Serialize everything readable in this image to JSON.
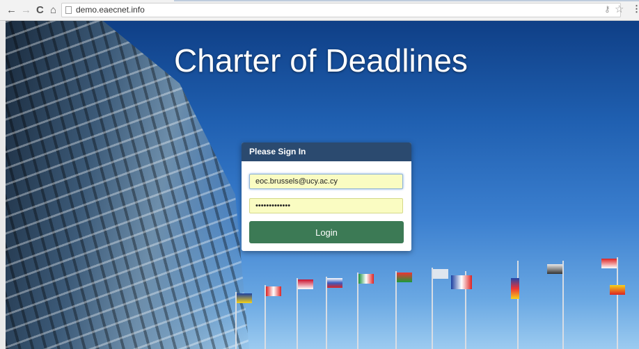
{
  "browser": {
    "url": "demo.eaecnet.info",
    "back_glyph": "←",
    "forward_glyph": "→",
    "reload_glyph": "C",
    "home_glyph": "⌂",
    "key_glyph": "⚷",
    "star_glyph": "☆",
    "menu_glyph": "⋮"
  },
  "page": {
    "title": "Charter of Deadlines"
  },
  "login": {
    "heading": "Please Sign In",
    "email_value": "eoc.brussels@ucy.ac.cy",
    "password_value": "•••••••••••••",
    "button_label": "Login"
  },
  "colors": {
    "panel_header": "#2b4a6f",
    "button": "#3c7a55",
    "field_bg": "#fafcc2"
  }
}
